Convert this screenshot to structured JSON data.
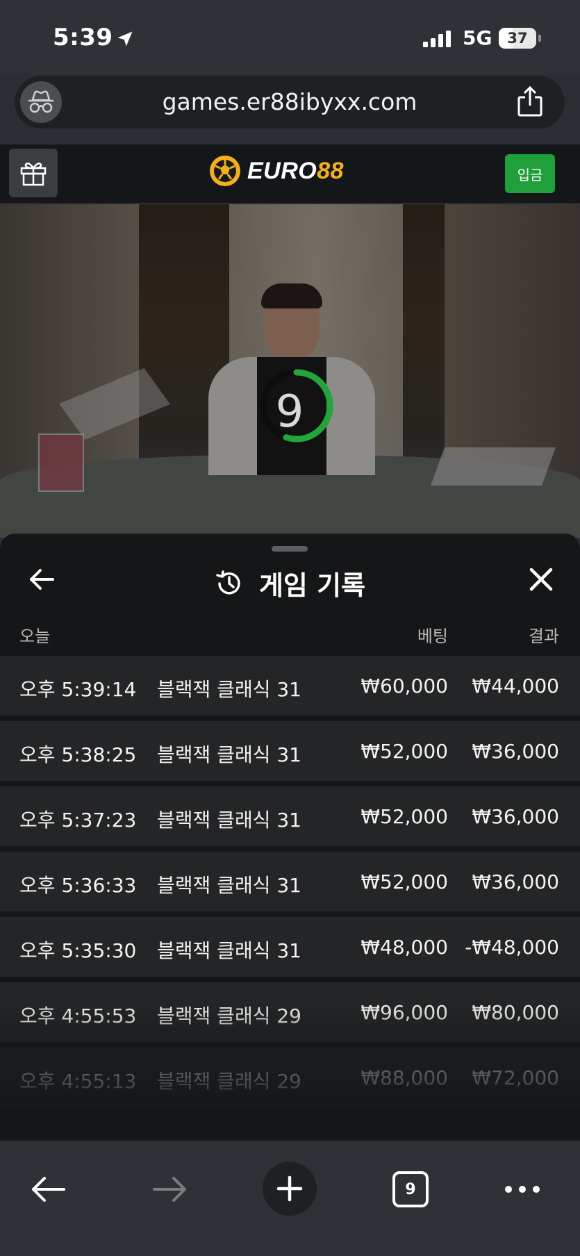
{
  "status_bar": {
    "time": "5:39",
    "network": "5G",
    "battery": "37",
    "battery_level_percent": 37
  },
  "browser": {
    "url": "games.er88ibyxx.com",
    "tab_count": "9"
  },
  "site": {
    "logo_part1": "EURO",
    "logo_part2": "88",
    "deposit_label": "입금"
  },
  "video": {
    "countdown": "9",
    "countdown_fraction": 0.55
  },
  "history": {
    "title": "게임 기록",
    "columns": {
      "today": "오늘",
      "bet": "베팅",
      "result": "결과"
    },
    "rows": [
      {
        "time": "오후 5:39:14",
        "game": "블랙잭 클래식 31",
        "bet": "₩60,000",
        "result": "₩44,000"
      },
      {
        "time": "오후 5:38:25",
        "game": "블랙잭 클래식 31",
        "bet": "₩52,000",
        "result": "₩36,000"
      },
      {
        "time": "오후 5:37:23",
        "game": "블랙잭 클래식 31",
        "bet": "₩52,000",
        "result": "₩36,000"
      },
      {
        "time": "오후 5:36:33",
        "game": "블랙잭 클래식 31",
        "bet": "₩52,000",
        "result": "₩36,000"
      },
      {
        "time": "오후 5:35:30",
        "game": "블랙잭 클래식 31",
        "bet": "₩48,000",
        "result": "-₩48,000"
      },
      {
        "time": "오후 4:55:53",
        "game": "블랙잭 클래식 29",
        "bet": "₩96,000",
        "result": "₩80,000"
      },
      {
        "time": "오후 4:55:13",
        "game": "블랙잭 클래식 29",
        "bet": "₩88,000",
        "result": "₩72,000"
      }
    ]
  },
  "colors": {
    "accent_green": "#1fa03b",
    "logo_gold": "#f2b01e",
    "sheet_bg": "#141618",
    "row_bg": "#232527"
  },
  "icons": [
    "navigation-arrow-icon",
    "signal-bars-icon",
    "incognito-icon",
    "share-icon",
    "gift-icon",
    "soccer-ball-icon",
    "back-arrow-icon",
    "history-icon",
    "close-icon",
    "forward-arrow-icon",
    "plus-icon",
    "tabs-icon",
    "more-icon"
  ]
}
